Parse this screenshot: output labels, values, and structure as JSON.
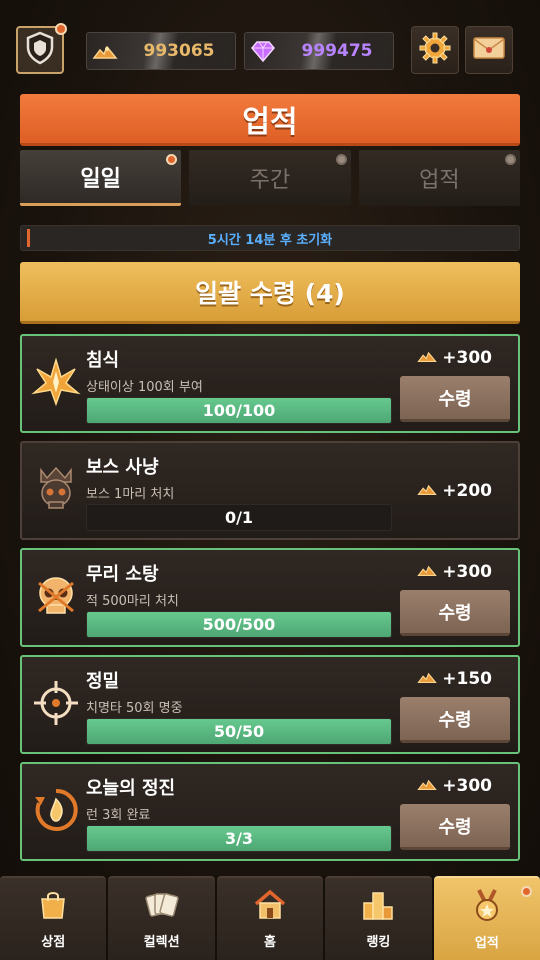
{
  "top": {
    "gold": "993065",
    "gems": "999475",
    "icons": {
      "profile": "shield-profile-icon",
      "gold": "gold-pile-icon",
      "gem": "gem-icon",
      "settings": "gear-icon",
      "mail": "envelope-icon"
    }
  },
  "title": "업적",
  "tabs": [
    {
      "label": "일일",
      "active": true
    },
    {
      "label": "주간",
      "active": false
    },
    {
      "label": "업적",
      "active": false
    }
  ],
  "reset_text": "5시간 14분 후 초기화",
  "claim_all": "일괄 수령 (4)",
  "quests": [
    {
      "title": "침식",
      "desc": "상태이상 100회 부여",
      "progress": "100/100",
      "fraction": 1.0,
      "reward": "+300",
      "claim": "수령",
      "icon": "crystal-burst-icon"
    },
    {
      "title": "보스 사냥",
      "desc": "보스 1마리 처치",
      "progress": "0/1",
      "fraction": 0.0,
      "reward": "+200",
      "claim": "",
      "icon": "crowned-skull-icon"
    },
    {
      "title": "무리 소탕",
      "desc": "적 500마리 처치",
      "progress": "500/500",
      "fraction": 1.0,
      "reward": "+300",
      "claim": "수령",
      "icon": "skull-icon"
    },
    {
      "title": "정밀",
      "desc": "치명타 50회 명중",
      "progress": "50/50",
      "fraction": 1.0,
      "reward": "+150",
      "claim": "수령",
      "icon": "crosshair-icon"
    },
    {
      "title": "오늘의 정진",
      "desc": "런 3회 완료",
      "progress": "3/3",
      "fraction": 1.0,
      "reward": "+300",
      "claim": "수령",
      "icon": "fire-cycle-icon"
    }
  ],
  "nav": [
    {
      "label": "상점",
      "icon": "shop-bag-icon",
      "active": false
    },
    {
      "label": "컬렉션",
      "icon": "cards-icon",
      "active": false
    },
    {
      "label": "홈",
      "icon": "home-icon",
      "active": false
    },
    {
      "label": "랭킹",
      "icon": "ranking-icon",
      "active": false
    },
    {
      "label": "업적",
      "icon": "medal-icon",
      "active": true
    }
  ],
  "colors": {
    "accent_orange": "#e86a2f",
    "claim_gold": "#e3ad49",
    "complete_green": "#68c279",
    "reset_blue": "#5ab0ff"
  }
}
